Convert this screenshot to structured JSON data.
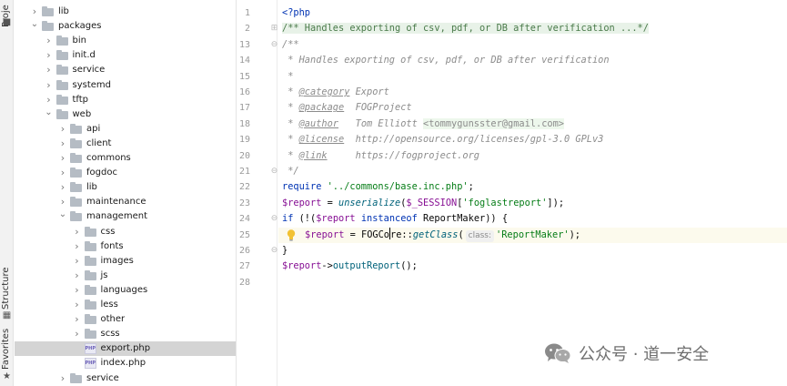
{
  "sidebar_strip": {
    "project_label": "Proje",
    "structure_label": "Structure",
    "favorites_label": "Favorites"
  },
  "tree": {
    "rows": [
      {
        "label": "lib",
        "kind": "folder",
        "depth": 1,
        "expanded": false,
        "selected": false
      },
      {
        "label": "packages",
        "kind": "folder",
        "depth": 1,
        "expanded": true,
        "selected": false
      },
      {
        "label": "bin",
        "kind": "folder",
        "depth": 2,
        "expanded": false,
        "selected": false
      },
      {
        "label": "init.d",
        "kind": "folder",
        "depth": 2,
        "expanded": false,
        "selected": false
      },
      {
        "label": "service",
        "kind": "folder",
        "depth": 2,
        "expanded": false,
        "selected": false
      },
      {
        "label": "systemd",
        "kind": "folder",
        "depth": 2,
        "expanded": false,
        "selected": false
      },
      {
        "label": "tftp",
        "kind": "folder",
        "depth": 2,
        "expanded": false,
        "selected": false
      },
      {
        "label": "web",
        "kind": "folder",
        "depth": 2,
        "expanded": true,
        "selected": false
      },
      {
        "label": "api",
        "kind": "folder",
        "depth": 3,
        "expanded": false,
        "selected": false
      },
      {
        "label": "client",
        "kind": "folder",
        "depth": 3,
        "expanded": false,
        "selected": false
      },
      {
        "label": "commons",
        "kind": "folder",
        "depth": 3,
        "expanded": false,
        "selected": false
      },
      {
        "label": "fogdoc",
        "kind": "folder",
        "depth": 3,
        "expanded": false,
        "selected": false
      },
      {
        "label": "lib",
        "kind": "folder",
        "depth": 3,
        "expanded": false,
        "selected": false
      },
      {
        "label": "maintenance",
        "kind": "folder",
        "depth": 3,
        "expanded": false,
        "selected": false
      },
      {
        "label": "management",
        "kind": "folder",
        "depth": 3,
        "expanded": true,
        "selected": false
      },
      {
        "label": "css",
        "kind": "folder",
        "depth": 4,
        "expanded": false,
        "selected": false
      },
      {
        "label": "fonts",
        "kind": "folder",
        "depth": 4,
        "expanded": false,
        "selected": false
      },
      {
        "label": "images",
        "kind": "folder",
        "depth": 4,
        "expanded": false,
        "selected": false
      },
      {
        "label": "js",
        "kind": "folder",
        "depth": 4,
        "expanded": false,
        "selected": false
      },
      {
        "label": "languages",
        "kind": "folder",
        "depth": 4,
        "expanded": false,
        "selected": false
      },
      {
        "label": "less",
        "kind": "folder",
        "depth": 4,
        "expanded": false,
        "selected": false
      },
      {
        "label": "other",
        "kind": "folder",
        "depth": 4,
        "expanded": false,
        "selected": false
      },
      {
        "label": "scss",
        "kind": "folder",
        "depth": 4,
        "expanded": false,
        "selected": false
      },
      {
        "label": "export.php",
        "kind": "php",
        "depth": 4,
        "expanded": false,
        "selected": true
      },
      {
        "label": "index.php",
        "kind": "php",
        "depth": 4,
        "expanded": false,
        "selected": false
      },
      {
        "label": "service",
        "kind": "folder",
        "depth": 3,
        "expanded": false,
        "selected": false
      }
    ],
    "php_badge": "PHP"
  },
  "gutter": {
    "line_numbers": [
      "1",
      "2",
      "13",
      "14",
      "15",
      "16",
      "17",
      "18",
      "19",
      "20",
      "21",
      "22",
      "23",
      "24",
      "25",
      "26",
      "27",
      "28"
    ]
  },
  "editor": {
    "current_line": 25,
    "lines": [
      [
        {
          "c": "kw",
          "t": "<?php"
        }
      ],
      [
        {
          "c": "fold-region",
          "t": "/** Handles exporting of csv, pdf, or DB after verification ...*/"
        }
      ],
      [
        {
          "c": "cmt",
          "t": "/**"
        }
      ],
      [
        {
          "c": "cmt",
          "t": " * Handles exporting of csv, pdf, or DB after verification"
        }
      ],
      [
        {
          "c": "cmt",
          "t": " *"
        }
      ],
      [
        {
          "c": "cmt",
          "t": " * "
        },
        {
          "c": "tag",
          "t": "@category"
        },
        {
          "c": "cmt",
          "t": " Export"
        }
      ],
      [
        {
          "c": "cmt",
          "t": " * "
        },
        {
          "c": "tag",
          "t": "@package"
        },
        {
          "c": "cmt",
          "t": "  FOGProject"
        }
      ],
      [
        {
          "c": "cmt",
          "t": " * "
        },
        {
          "c": "tag",
          "t": "@author"
        },
        {
          "c": "cmt",
          "t": "   Tom Elliott "
        },
        {
          "c": "email",
          "t": "<tommygunsster@gmail.com>"
        }
      ],
      [
        {
          "c": "cmt",
          "t": " * "
        },
        {
          "c": "tag",
          "t": "@license"
        },
        {
          "c": "cmt",
          "t": "  http://opensource.org/licenses/gpl-3.0 GPLv3"
        }
      ],
      [
        {
          "c": "cmt",
          "t": " * "
        },
        {
          "c": "tag",
          "t": "@link"
        },
        {
          "c": "cmt",
          "t": "     https://fogproject.org"
        }
      ],
      [
        {
          "c": "cmt",
          "t": " */"
        }
      ],
      [
        {
          "c": "kw",
          "t": "require "
        },
        {
          "c": "str",
          "t": "'../commons/base.inc.php'"
        },
        {
          "c": "typ",
          "t": ";"
        }
      ],
      [
        {
          "c": "var",
          "t": "$report"
        },
        {
          "c": "typ",
          "t": " = "
        },
        {
          "c": "fn",
          "t": "unserialize"
        },
        {
          "c": "typ",
          "t": "("
        },
        {
          "c": "var",
          "t": "$_SESSION"
        },
        {
          "c": "typ",
          "t": "["
        },
        {
          "c": "str",
          "t": "'foglastreport'"
        },
        {
          "c": "typ",
          "t": "]);"
        }
      ],
      [
        {
          "c": "kw",
          "t": "if"
        },
        {
          "c": "typ",
          "t": " (!("
        },
        {
          "c": "var",
          "t": "$report"
        },
        {
          "c": "kw",
          "t": " instanceof"
        },
        {
          "c": "typ",
          "t": " ReportMaker)) {"
        }
      ],
      [
        {
          "c": "typ",
          "t": "    "
        },
        {
          "c": "var",
          "t": "$report"
        },
        {
          "c": "typ",
          "t": " = FOGCo"
        },
        {
          "c": "caret",
          "t": ""
        },
        {
          "c": "typ",
          "t": "re::"
        },
        {
          "c": "fn",
          "t": "getClass"
        },
        {
          "c": "typ",
          "t": "("
        },
        {
          "c": "hint",
          "t": "class:"
        },
        {
          "c": "str",
          "t": "'ReportMaker'"
        },
        {
          "c": "typ",
          "t": ");"
        }
      ],
      [
        {
          "c": "typ",
          "t": "}"
        }
      ],
      [
        {
          "c": "var",
          "t": "$report"
        },
        {
          "c": "typ",
          "t": "->"
        },
        {
          "c": "mth",
          "t": "outputReport"
        },
        {
          "c": "typ",
          "t": "();"
        }
      ],
      []
    ]
  },
  "watermark": {
    "text": "公众号 · 道一安全",
    "icon": "wechat-icon"
  }
}
